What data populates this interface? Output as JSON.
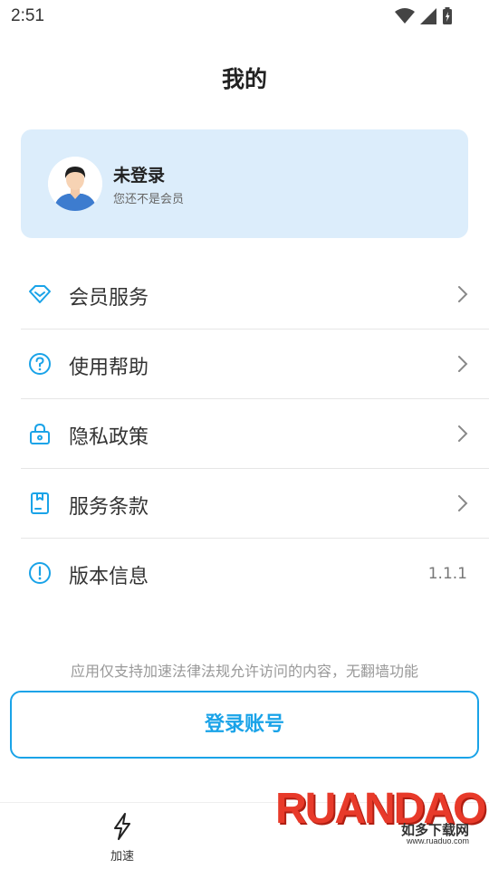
{
  "status_bar": {
    "time": "2:51"
  },
  "header": {
    "title": "我的"
  },
  "profile": {
    "name": "未登录",
    "subtitle": "您还不是会员"
  },
  "menu": [
    {
      "label": "会员服务",
      "icon": "diamond-icon"
    },
    {
      "label": "使用帮助",
      "icon": "help-circle-icon"
    },
    {
      "label": "隐私政策",
      "icon": "lock-icon"
    },
    {
      "label": "服务条款",
      "icon": "document-icon"
    },
    {
      "label": "版本信息",
      "icon": "info-icon",
      "value": "1.1.1"
    }
  ],
  "notice": "应用仅支持加速法律法规允许访问的内容，无翻墙功能",
  "login_button": "登录账号",
  "bottom_nav": {
    "accelerate_label": "加速"
  },
  "watermark": {
    "brand": "RUANDAO",
    "sub": "如多下载网",
    "url": "www.ruaduo.com"
  },
  "colors": {
    "accent": "#1aa3e8",
    "card_bg": "#dcedfb",
    "brand_red": "#e83a2a"
  }
}
